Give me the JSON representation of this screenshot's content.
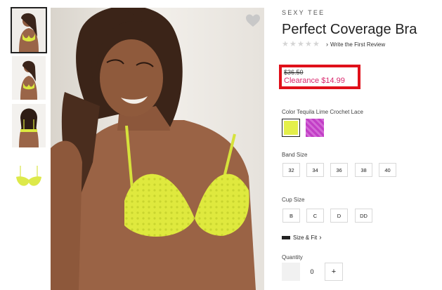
{
  "product": {
    "brand": "SEXY TEE",
    "title": "Perfect Coverage Bra",
    "review_link": "Write the First Review",
    "original_price": "$36.50",
    "clearance_price": "Clearance $14.99"
  },
  "color": {
    "label": "Color Tequila Lime Crochet Lace",
    "swatches": [
      {
        "name": "Tequila Lime Crochet Lace",
        "hex": "#e4ef4a",
        "selected": true
      },
      {
        "name": "Purple Lace",
        "hex": "#c23ec6",
        "selected": false
      }
    ]
  },
  "band_size": {
    "label": "Band Size",
    "options": [
      "32",
      "34",
      "36",
      "38",
      "40"
    ]
  },
  "cup_size": {
    "label": "Cup Size",
    "options": [
      "B",
      "C",
      "D",
      "DD"
    ]
  },
  "size_fit": "Size & Fit",
  "quantity": {
    "label": "Quantity",
    "value": "0",
    "plus": "+"
  },
  "colors": {
    "highlight_border": "#e0101a",
    "sale_price": "#d9266c",
    "product_lime": "#e4ef4a"
  }
}
